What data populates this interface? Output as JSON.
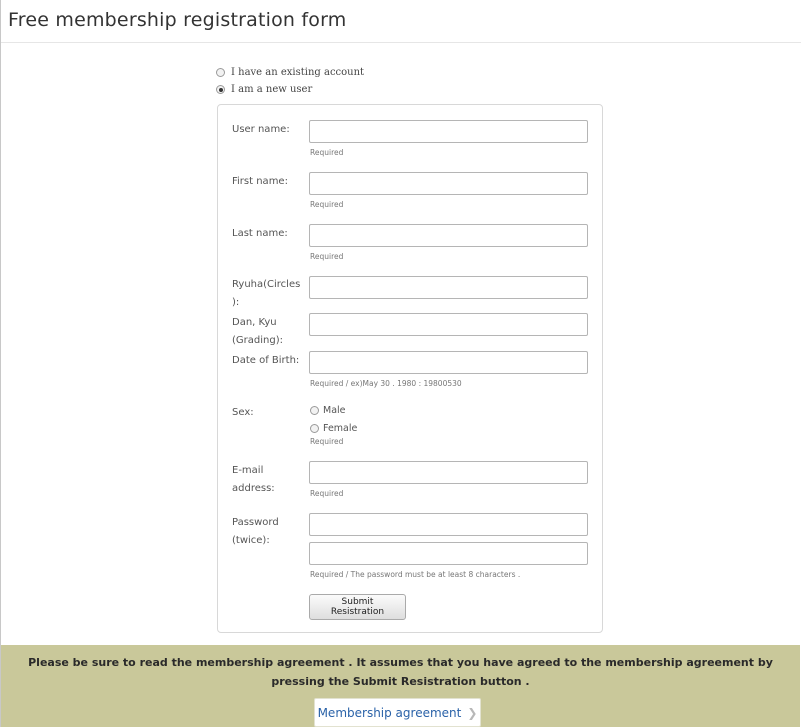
{
  "page": {
    "title": "Free membership registration form"
  },
  "account_type": {
    "existing_label": "I have an existing account",
    "new_label": "I am a new user",
    "selected": "new"
  },
  "form": {
    "username_label": "User name:",
    "username_hint": "Required",
    "firstname_label": "First name:",
    "firstname_hint": "Required",
    "lastname_label": "Last name:",
    "lastname_hint": "Required",
    "ryuha_label_1": "Ryuha(Circles",
    "ryuha_label_2": "):",
    "dan_label_1": "Dan, Kyu",
    "dan_label_2": "(Grading):",
    "dob_label": "Date of Birth:",
    "dob_hint": "Required  /  ex)May 30 . 1980 :  19800530",
    "sex_label": "Sex:",
    "sex_male": "Male",
    "sex_female": "Female",
    "sex_hint": "Required",
    "email_label_1": "E-mail",
    "email_label_2": "address:",
    "email_hint": "Required",
    "password_label_1": "Password",
    "password_label_2": "(twice):",
    "password_hint": "Required  /   The password must be at least 8 characters .",
    "submit_label": "Submit Resistration"
  },
  "footer": {
    "notice": "Please be sure to read the membership agreement . It assumes that you have agreed to the membership agreement by pressing the Submit Resistration button .",
    "agreement_label": "Membership agreement",
    "agreement_icon": "chevron-right-icon"
  }
}
